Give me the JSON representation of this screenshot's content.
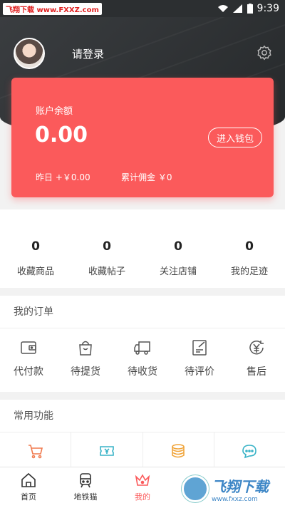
{
  "status_bar": {
    "watermark": "飞翔下载 www.FXXZ.com",
    "time": "9:39"
  },
  "header": {
    "login_label": "请登录"
  },
  "card": {
    "balance_label": "账户余额",
    "balance_value": "0.00",
    "wallet_button": "进入钱包",
    "yesterday": "昨日 +￥0.00",
    "commission": "累计佣金 ￥0"
  },
  "stats": [
    {
      "value": "0",
      "label": "收藏商品"
    },
    {
      "value": "0",
      "label": "收藏帖子"
    },
    {
      "value": "0",
      "label": "关注店铺"
    },
    {
      "value": "0",
      "label": "我的足迹"
    }
  ],
  "orders": {
    "title": "我的订单",
    "items": [
      {
        "label": "代付款",
        "icon": "wallet-icon"
      },
      {
        "label": "待提货",
        "icon": "bag-icon"
      },
      {
        "label": "待收货",
        "icon": "truck-icon"
      },
      {
        "label": "待评价",
        "icon": "review-icon"
      },
      {
        "label": "售后",
        "icon": "yen-icon"
      }
    ]
  },
  "functions": {
    "title": "常用功能",
    "items": [
      {
        "icon": "cart-icon",
        "color": "#f07a4e"
      },
      {
        "icon": "ticket-icon",
        "color": "#39b3c7"
      },
      {
        "icon": "coins-icon",
        "color": "#f0a43a"
      },
      {
        "icon": "chat-icon",
        "color": "#39b3c7"
      }
    ]
  },
  "nav": [
    {
      "label": "首页",
      "icon": "home-icon"
    },
    {
      "label": "地铁猫",
      "icon": "metro-icon"
    },
    {
      "label": "我的",
      "icon": "crown-icon"
    }
  ],
  "watermark_bottom": {
    "big": "飞翔下载",
    "small": "www.fxxz.com"
  },
  "colors": {
    "accent": "#fb5a5b",
    "header_dark": "#2c2f31"
  }
}
